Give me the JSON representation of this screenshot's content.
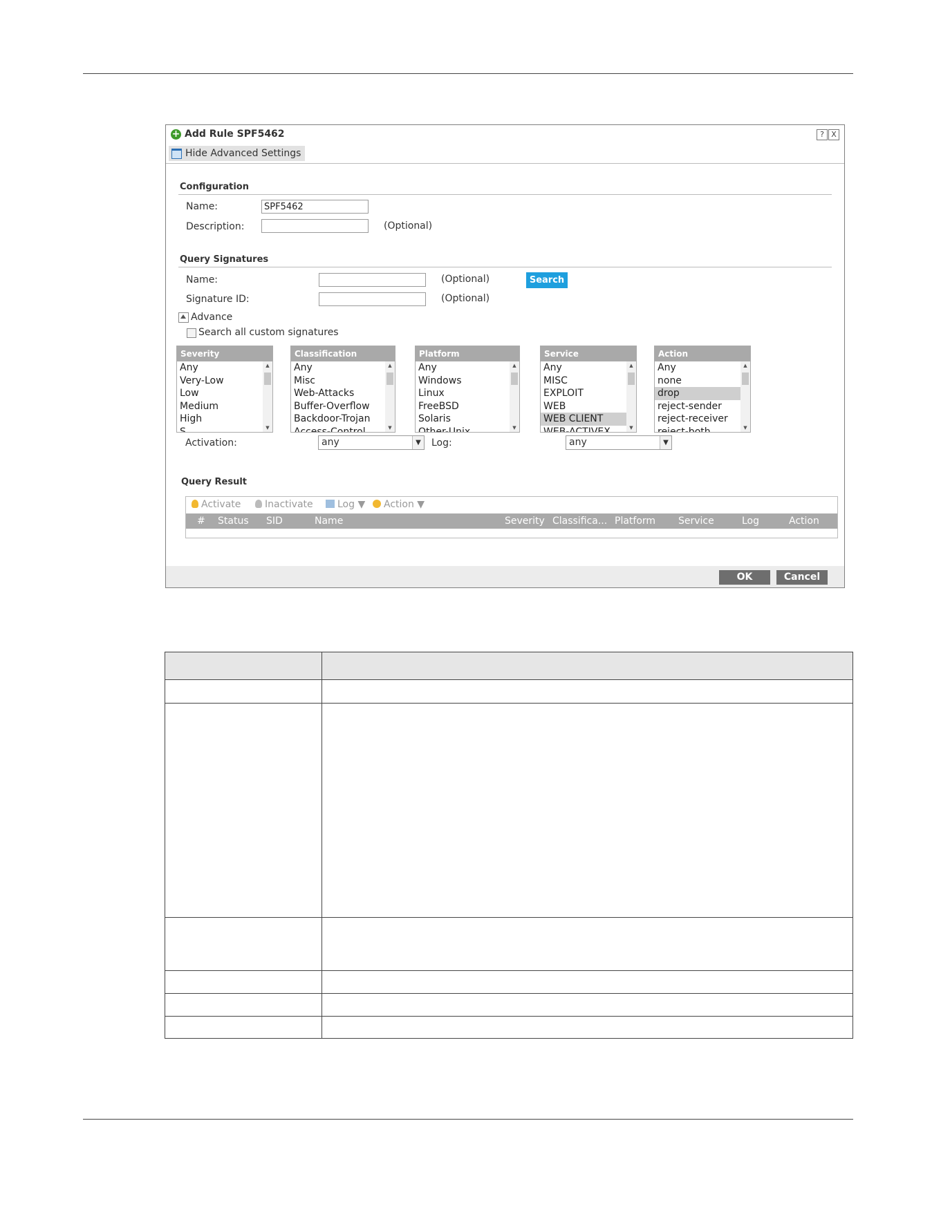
{
  "dialog": {
    "title": "Add Rule SPF5462",
    "help_label": "?",
    "close_label": "X",
    "hide_advanced_label": "Hide Advanced Settings"
  },
  "configuration": {
    "heading": "Configuration",
    "name_label": "Name:",
    "name_value": "SPF5462",
    "description_label": "Description:",
    "description_value": "",
    "description_optional": "(Optional)"
  },
  "query_signatures": {
    "heading": "Query Signatures",
    "name_label": "Name:",
    "name_value": "",
    "name_optional": "(Optional)",
    "search_label": "Search",
    "signature_id_label": "Signature ID:",
    "signature_id_value": "",
    "signature_id_optional": "(Optional)",
    "advance_label": "Advance",
    "search_custom_label": "Search all custom signatures",
    "lists": {
      "severity": {
        "header": "Severity",
        "items": [
          "Any",
          "Very-Low",
          "Low",
          "Medium",
          "High",
          "S"
        ]
      },
      "classification": {
        "header": "Classification",
        "items": [
          "Any",
          "Misc",
          "Web-Attacks",
          "Buffer-Overflow",
          "Backdoor-Trojan",
          "Access-Control"
        ]
      },
      "platform": {
        "header": "Platform",
        "items": [
          "Any",
          "Windows",
          "Linux",
          "FreeBSD",
          "Solaris",
          "Other-Unix"
        ]
      },
      "service": {
        "header": "Service",
        "items": [
          "Any",
          "MISC",
          "EXPLOIT",
          "WEB",
          "WEB CLIENT",
          "WEB-ACTIVEX"
        ],
        "selected": "WEB CLIENT"
      },
      "action": {
        "header": "Action",
        "items": [
          "Any",
          "none",
          "drop",
          "reject-sender",
          "reject-receiver",
          "reject-both"
        ],
        "selected": "drop"
      }
    },
    "activation_label": "Activation:",
    "activation_value": "any",
    "log_label": "Log:",
    "log_value": "any"
  },
  "query_result": {
    "heading": "Query Result",
    "toolbar": {
      "activate": "Activate",
      "inactivate": "Inactivate",
      "log": "Log",
      "action": "Action"
    },
    "columns": [
      "#",
      "Status",
      "SID",
      "Name",
      "Severity",
      "Classifica...",
      "Platform",
      "Service",
      "Log",
      "Action"
    ]
  },
  "footer": {
    "ok_label": "OK",
    "cancel_label": "Cancel"
  },
  "colors": {
    "accent": "#1e9fde",
    "add_icon": "#3e9b2a",
    "header_gray": "#a9a9a9",
    "button_gray": "#6e6e6e"
  }
}
